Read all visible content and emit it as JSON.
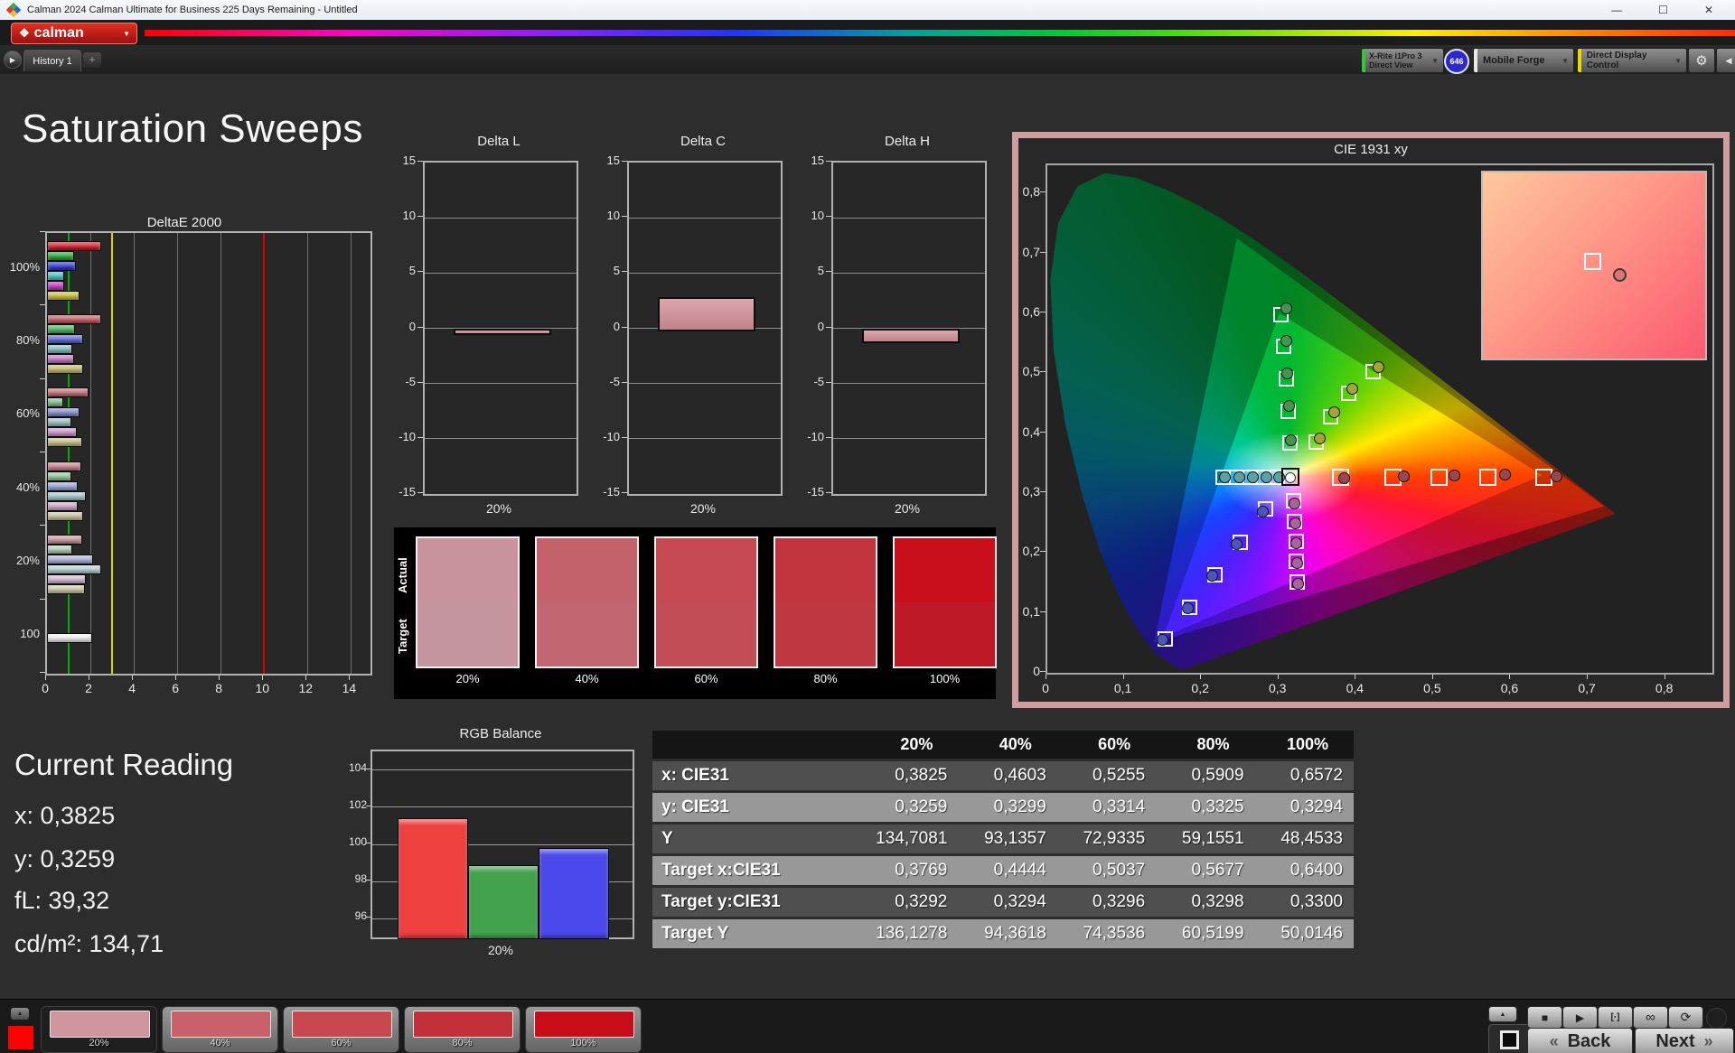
{
  "window": {
    "title": "Calman 2024 Calman Ultimate for Business 225 Days Remaining  - Untitled"
  },
  "app_bar": {
    "logo": "calman",
    "brand_red": "#c41414"
  },
  "tab_bar": {
    "history_tab": "History 1",
    "add_tab": "+"
  },
  "meter_bar": {
    "meter_line1": "X-Rite i1Pro 3",
    "meter_line2": "Direct View",
    "badge": "646",
    "source": "Mobile Forge",
    "workflow": "Direct Display Control",
    "meter_accent": "#2ecc2e",
    "source_accent": "#e8e8e8",
    "workflow_accent": "#e8d800"
  },
  "page": {
    "title": "Saturation Sweeps"
  },
  "current_reading": {
    "title": "Current Reading",
    "x": "x: 0,3825",
    "y": "y: 0,3259",
    "fl": "fL: 39,32",
    "cd": "cd/m²: 134,71"
  },
  "actual_target": {
    "row1": "Actual",
    "row2": "Target",
    "columns": [
      {
        "label": "20%",
        "actual": "#c9939e",
        "target": "#c5949f"
      },
      {
        "label": "40%",
        "actual": "#c4626b",
        "target": "#c26570"
      },
      {
        "label": "60%",
        "actual": "#c54a52",
        "target": "#c34d57"
      },
      {
        "label": "80%",
        "actual": "#c1333d",
        "target": "#bf3741"
      },
      {
        "label": "100%",
        "actual": "#c90f1c",
        "target": "#bd1926"
      }
    ]
  },
  "table": {
    "columns": [
      "20%",
      "40%",
      "60%",
      "80%",
      "100%"
    ],
    "rows": [
      {
        "label": "x: CIE31",
        "values": [
          "0,3825",
          "0,4603",
          "0,5255",
          "0,5909",
          "0,6572"
        ]
      },
      {
        "label": "y: CIE31",
        "values": [
          "0,3259",
          "0,3299",
          "0,3314",
          "0,3325",
          "0,3294"
        ]
      },
      {
        "label": "Y",
        "values": [
          "134,7081",
          "93,1357",
          "72,9335",
          "59,1551",
          "48,4533"
        ]
      },
      {
        "label": "Target x:CIE31",
        "values": [
          "0,3769",
          "0,4444",
          "0,5037",
          "0,5677",
          "0,6400"
        ]
      },
      {
        "label": "Target y:CIE31",
        "values": [
          "0,3292",
          "0,3294",
          "0,3296",
          "0,3298",
          "0,3300"
        ]
      },
      {
        "label": "Target Y",
        "values": [
          "136,1278",
          "94,3618",
          "74,3536",
          "60,5199",
          "50,0146"
        ]
      }
    ]
  },
  "bottom_bar": {
    "patches": [
      {
        "label": "20%",
        "color": "#cf96a0",
        "selected": true
      },
      {
        "label": "40%",
        "color": "#c9616a",
        "selected": false
      },
      {
        "label": "60%",
        "color": "#c8484f",
        "selected": false
      },
      {
        "label": "80%",
        "color": "#c23039",
        "selected": false
      },
      {
        "label": "100%",
        "color": "#c60d19",
        "selected": false
      }
    ],
    "back_label": "Back",
    "next_label": "Next"
  },
  "chart_data": {
    "deltae2000": {
      "type": "bar",
      "orientation": "horizontal",
      "title": "DeltaE 2000",
      "xlim": [
        0,
        14.9
      ],
      "xticks": [
        0,
        2,
        4,
        6,
        8,
        10,
        12,
        14
      ],
      "reference_lines": [
        {
          "value": 1,
          "color": "#00b000"
        },
        {
          "value": 3,
          "color": "#d6d600"
        },
        {
          "value": 10,
          "color": "#dd0000"
        }
      ],
      "groups": [
        {
          "label": "100%",
          "values": [
            2.4,
            1.15,
            1.25,
            0.7,
            0.7,
            1.4
          ],
          "colors": [
            "#d01020",
            "#17a62b",
            "#2a2fd8",
            "#37c4c4",
            "#c32ec3",
            "#c9bd2e"
          ]
        },
        {
          "label": "80%",
          "values": [
            2.4,
            1.2,
            1.6,
            1.1,
            1.15,
            1.6
          ],
          "colors": [
            "#c4555d",
            "#43b156",
            "#5a63cf",
            "#7fbdc1",
            "#c272c0",
            "#c5ba67"
          ]
        },
        {
          "label": "60%",
          "values": [
            1.85,
            0.65,
            1.4,
            1.05,
            1.3,
            1.55
          ],
          "colors": [
            "#c16a70",
            "#77c184",
            "#7f88d0",
            "#92bec3",
            "#ca90c7",
            "#c4bd7e"
          ]
        },
        {
          "label": "40%",
          "values": [
            1.5,
            1.05,
            1.35,
            1.7,
            1.35,
            1.6
          ],
          "colors": [
            "#c37f85",
            "#92c79a",
            "#99a0d6",
            "#a2c5c9",
            "#cda5cb",
            "#c7c295"
          ]
        },
        {
          "label": "20%",
          "values": [
            1.55,
            1.1,
            2.05,
            2.4,
            1.7,
            1.65
          ],
          "colors": [
            "#c7939c",
            "#a9cfaf",
            "#abb2da",
            "#b4cfd2",
            "#d4b7d3",
            "#cdc9a7"
          ]
        },
        {
          "label": "100",
          "values": [
            2.0
          ],
          "colors": [
            "#f2f2f2"
          ]
        }
      ]
    },
    "delta_l": {
      "type": "bar",
      "title": "Delta L",
      "ylim": [
        -15,
        15
      ],
      "yticks": [
        15,
        10,
        5,
        0,
        -5,
        -10,
        -15
      ],
      "categories": [
        "20%"
      ],
      "values": [
        -0.25
      ],
      "bar_color": "#c98f95"
    },
    "delta_c": {
      "type": "bar",
      "title": "Delta C",
      "ylim": [
        -15,
        15
      ],
      "yticks": [
        15,
        10,
        5,
        0,
        -5,
        -10,
        -15
      ],
      "categories": [
        "20%"
      ],
      "values": [
        2.8
      ],
      "bar_color": "#c98f95"
    },
    "delta_h": {
      "type": "bar",
      "title": "Delta H",
      "ylim": [
        -15,
        15
      ],
      "yticks": [
        15,
        10,
        5,
        0,
        -5,
        -10,
        -15
      ],
      "categories": [
        "20%"
      ],
      "values": [
        -1.0
      ],
      "bar_color": "#c98f95"
    },
    "rgb_balance": {
      "type": "bar",
      "title": "RGB Balance",
      "ylim": [
        95,
        105
      ],
      "yticks": [
        96,
        98,
        100,
        102,
        104
      ],
      "categories": [
        "20%"
      ],
      "series": [
        {
          "name": "Red",
          "value": 101.4,
          "color": "#f04141"
        },
        {
          "name": "Green",
          "value": 98.9,
          "color": "#43a24d"
        },
        {
          "name": "Blue",
          "value": 99.8,
          "color": "#4b49ec"
        }
      ]
    },
    "cie1931": {
      "type": "scatter",
      "title": "CIE 1931 xy",
      "xlim": [
        0,
        0.86
      ],
      "ylim": [
        0,
        0.847
      ],
      "xtick_labels": [
        "0",
        "0,1",
        "0,2",
        "0,3",
        "0,4",
        "0,5",
        "0,6",
        "0,7",
        "0,8"
      ],
      "ytick_labels": [
        "0",
        "0,1",
        "0,2",
        "0,3",
        "0,4",
        "0,5",
        "0,6",
        "0,7",
        "0,8"
      ],
      "locus": [
        [
          0.1741,
          0.005
        ],
        [
          0.1566,
          0.0177
        ],
        [
          0.144,
          0.0297
        ],
        [
          0.1355,
          0.0399
        ],
        [
          0.1241,
          0.0578
        ],
        [
          0.1096,
          0.0868
        ],
        [
          0.0913,
          0.1327
        ],
        [
          0.0687,
          0.2007
        ],
        [
          0.0454,
          0.295
        ],
        [
          0.0235,
          0.4127
        ],
        [
          0.0082,
          0.5384
        ],
        [
          0.0039,
          0.6548
        ],
        [
          0.0139,
          0.7502
        ],
        [
          0.0389,
          0.812
        ],
        [
          0.0743,
          0.8338
        ],
        [
          0.1142,
          0.8262
        ],
        [
          0.1547,
          0.8059
        ],
        [
          0.1929,
          0.7816
        ],
        [
          0.2296,
          0.7543
        ],
        [
          0.2658,
          0.7243
        ],
        [
          0.3016,
          0.6923
        ],
        [
          0.3373,
          0.6589
        ],
        [
          0.3731,
          0.6245
        ],
        [
          0.4087,
          0.5896
        ],
        [
          0.4441,
          0.5547
        ],
        [
          0.4788,
          0.5202
        ],
        [
          0.5125,
          0.4866
        ],
        [
          0.5448,
          0.4544
        ],
        [
          0.5752,
          0.4242
        ],
        [
          0.6029,
          0.3965
        ],
        [
          0.627,
          0.3725
        ],
        [
          0.6482,
          0.3514
        ],
        [
          0.6658,
          0.334
        ],
        [
          0.6801,
          0.3197
        ],
        [
          0.6915,
          0.3083
        ],
        [
          0.7079,
          0.292
        ],
        [
          0.719,
          0.2809
        ],
        [
          0.7347,
          0.2653
        ]
      ],
      "gamut_outer": [
        [
          0.72,
          0.278
        ],
        [
          0.245,
          0.725
        ],
        [
          0.138,
          0.05
        ]
      ],
      "gamut_inner": [
        [
          0.64,
          0.33
        ],
        [
          0.3,
          0.6
        ],
        [
          0.15,
          0.06
        ]
      ],
      "white_point": {
        "target": [
          0.3127,
          0.329
        ],
        "measured": [
          0.313,
          0.327
        ]
      },
      "sweeps": [
        {
          "name": "red",
          "point_color": "#9a474d",
          "big": true,
          "targets": [
            [
              0.3769,
              0.3292
            ],
            [
              0.4444,
              0.3294
            ],
            [
              0.5037,
              0.3296
            ],
            [
              0.5677,
              0.3298
            ],
            [
              0.64,
              0.33
            ]
          ],
          "measured": [
            [
              0.3825,
              0.3259
            ],
            [
              0.4603,
              0.3299
            ],
            [
              0.5255,
              0.3314
            ],
            [
              0.5909,
              0.3325
            ],
            [
              0.6572,
              0.3294
            ]
          ]
        },
        {
          "name": "green",
          "point_color": "#46954e",
          "big": false,
          "targets": [
            [
              0.311,
              0.386
            ],
            [
              0.309,
              0.44
            ],
            [
              0.3065,
              0.494
            ],
            [
              0.3035,
              0.548
            ],
            [
              0.3,
              0.6
            ]
          ],
          "measured": [
            [
              0.314,
              0.39
            ],
            [
              0.311,
              0.447
            ],
            [
              0.309,
              0.501
            ],
            [
              0.308,
              0.556
            ],
            [
              0.308,
              0.61
            ]
          ]
        },
        {
          "name": "yellow",
          "point_color": "#a3a33e",
          "big": false,
          "targets": [
            [
              0.345,
              0.388
            ],
            [
              0.364,
              0.431
            ],
            [
              0.387,
              0.469
            ],
            [
              0.419,
              0.505
            ]
          ],
          "measured": [
            [
              0.351,
              0.393
            ],
            [
              0.37,
              0.437
            ],
            [
              0.393,
              0.475
            ],
            [
              0.427,
              0.511
            ]
          ]
        },
        {
          "name": "cyan",
          "point_color": "#5ba3a3",
          "big": false,
          "targets": [
            [
              0.295,
              0.329
            ],
            [
              0.2775,
              0.329
            ],
            [
              0.26,
              0.329
            ],
            [
              0.2425,
              0.329
            ],
            [
              0.225,
              0.329
            ]
          ],
          "measured": [
            [
              0.299,
              0.3285
            ],
            [
              0.282,
              0.3285
            ],
            [
              0.265,
              0.3285
            ],
            [
              0.247,
              0.3285
            ],
            [
              0.229,
              0.3285
            ]
          ]
        },
        {
          "name": "magenta",
          "point_color": "#a8649a",
          "big": false,
          "targets": [
            [
              0.316,
              0.29
            ],
            [
              0.3175,
              0.256
            ],
            [
              0.319,
              0.223
            ],
            [
              0.32,
              0.189
            ],
            [
              0.321,
              0.154
            ]
          ],
          "measured": [
            [
              0.318,
              0.284
            ],
            [
              0.3195,
              0.251
            ],
            [
              0.3205,
              0.218
            ],
            [
              0.3215,
              0.184
            ],
            [
              0.3225,
              0.15
            ]
          ]
        },
        {
          "name": "blue",
          "point_color": "#4a57b4",
          "big": false,
          "targets": [
            [
              0.28,
              0.276
            ],
            [
              0.247,
              0.221
            ],
            [
              0.214,
              0.167
            ],
            [
              0.182,
              0.113
            ],
            [
              0.15,
              0.06
            ]
          ],
          "measured": [
            [
              0.277,
              0.27
            ],
            [
              0.244,
              0.216
            ],
            [
              0.212,
              0.163
            ],
            [
              0.18,
              0.11
            ],
            [
              0.148,
              0.057
            ]
          ]
        }
      ],
      "inset": {
        "target_pos": [
          0.455,
          0.43
        ],
        "measured_pos": [
          0.585,
          0.515
        ]
      }
    }
  }
}
